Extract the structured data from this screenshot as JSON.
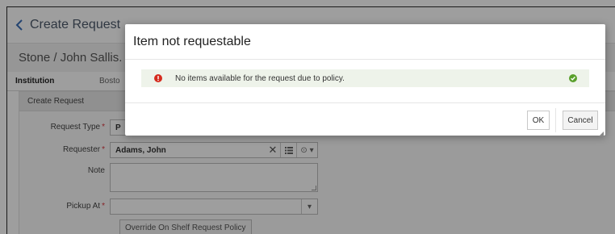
{
  "header": {
    "title": "Create Request",
    "back_icon": "chevron-left-icon"
  },
  "record": {
    "title": "Stone / John Sallis."
  },
  "tabs": {
    "institution_label": "Institution",
    "institution_value": "Bosto"
  },
  "form": {
    "panel_title": "Create Request",
    "request_type": {
      "label": "Request Type",
      "value": "P"
    },
    "requester": {
      "label": "Requester",
      "value": "Adams, John"
    },
    "note": {
      "label": "Note",
      "value": ""
    },
    "pickup": {
      "label": "Pickup At",
      "value": ""
    },
    "override_button": "Override On Shelf Request Policy",
    "required_marker": "*"
  },
  "modal": {
    "title": "Item not requestable",
    "alert_text": "No items available for the request due to policy.",
    "ok_label": "OK",
    "cancel_label": "Cancel"
  },
  "colors": {
    "accent": "#3b6fb6",
    "alert_bg": "#eef3ea",
    "error_red": "#d52b1e",
    "success_green": "#5aa02c",
    "overlay": "rgba(0,0,0,0.38)"
  }
}
